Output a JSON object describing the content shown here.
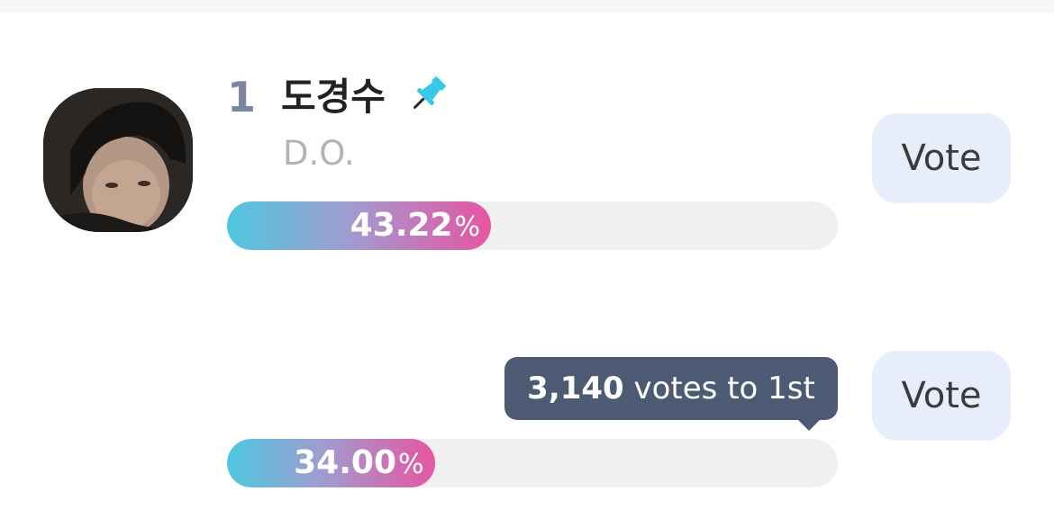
{
  "candidates": [
    {
      "rank": "1",
      "name": "도경수",
      "subname": "D.O.",
      "percent_value": "43.22",
      "percent_sign": "%",
      "percent": 43.22,
      "vote_label": "Vote",
      "pinned": true
    },
    {
      "percent_value": "34.00",
      "percent_sign": "%",
      "percent": 34.0,
      "vote_label": "Vote",
      "gap_votes": "3,140",
      "gap_text": " votes to 1st"
    }
  ],
  "colors": {
    "accent_cyan": "#4dc7df",
    "accent_pink": "#e755a2",
    "vote_button_bg": "#e7edfa",
    "tooltip_bg": "#4d5a74",
    "pin": "#35c9e8"
  },
  "icons": {
    "pin": "pin-icon"
  }
}
